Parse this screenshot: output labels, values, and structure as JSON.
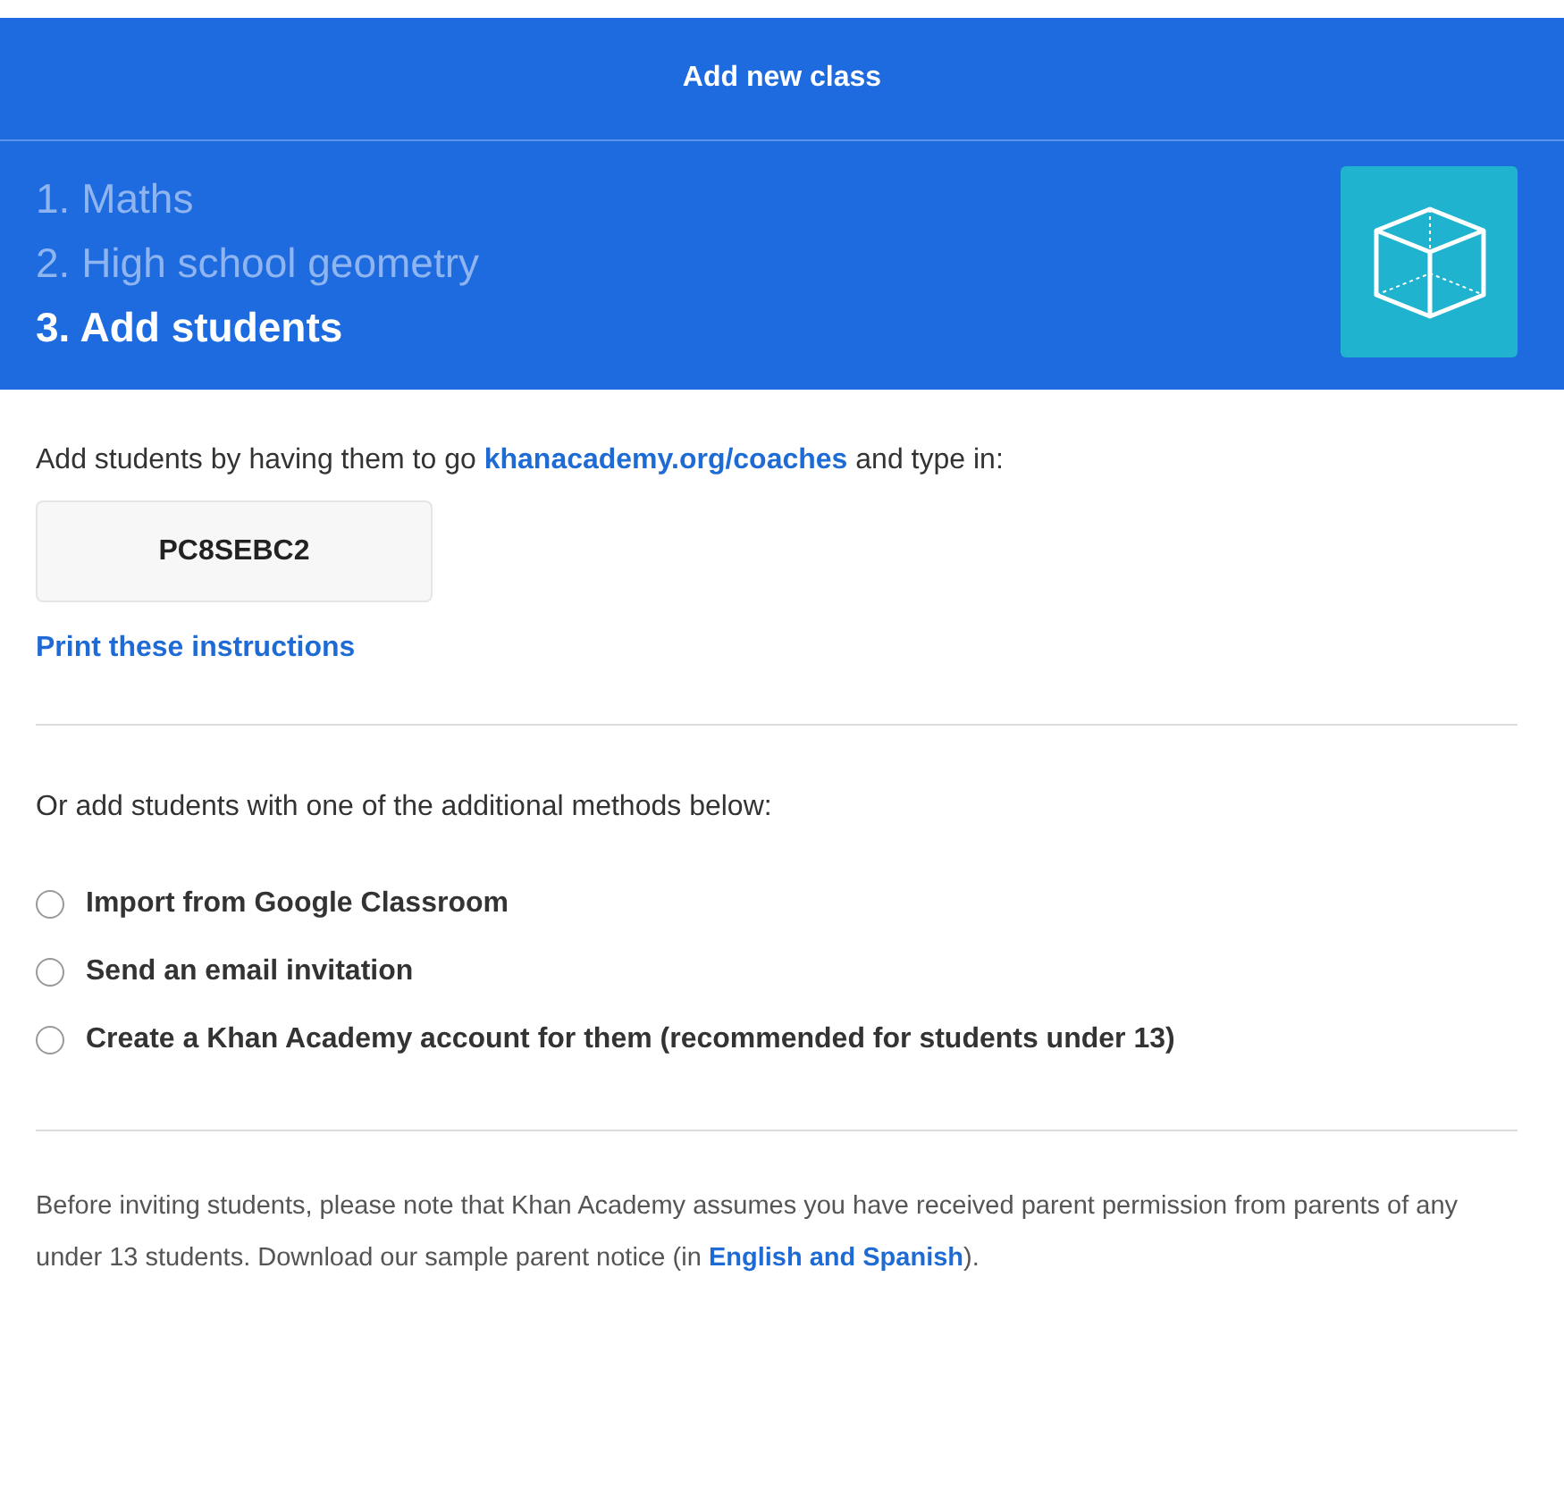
{
  "header": {
    "title": "Add new class"
  },
  "steps": [
    {
      "label": "1. Maths",
      "selected": false
    },
    {
      "label": "2. High school geometry",
      "selected": false
    },
    {
      "label": "3. Add students",
      "selected": true
    }
  ],
  "instructions": {
    "text_before": "Add students by having them to go",
    "link": "khanacademy.org/coaches",
    "text_after": "and type in:"
  },
  "class_code": "PC8SEBC2",
  "print_link": "Print these instructions",
  "methods_intro": "Or add students with one of the additional methods below:",
  "methods": [
    {
      "label": "Import from Google Classroom",
      "selected": false
    },
    {
      "label": "Send an email invitation",
      "selected": false
    },
    {
      "label": "Create a Khan Academy account for them (recommended for students under 13)",
      "selected": false
    }
  ],
  "note": {
    "text_before": "Before inviting students, please note that Khan Academy assumes you have received parent permission from parents of any under 13 students. Download our sample parent notice (in",
    "link": "English and Spanish",
    "text_after": ")."
  }
}
